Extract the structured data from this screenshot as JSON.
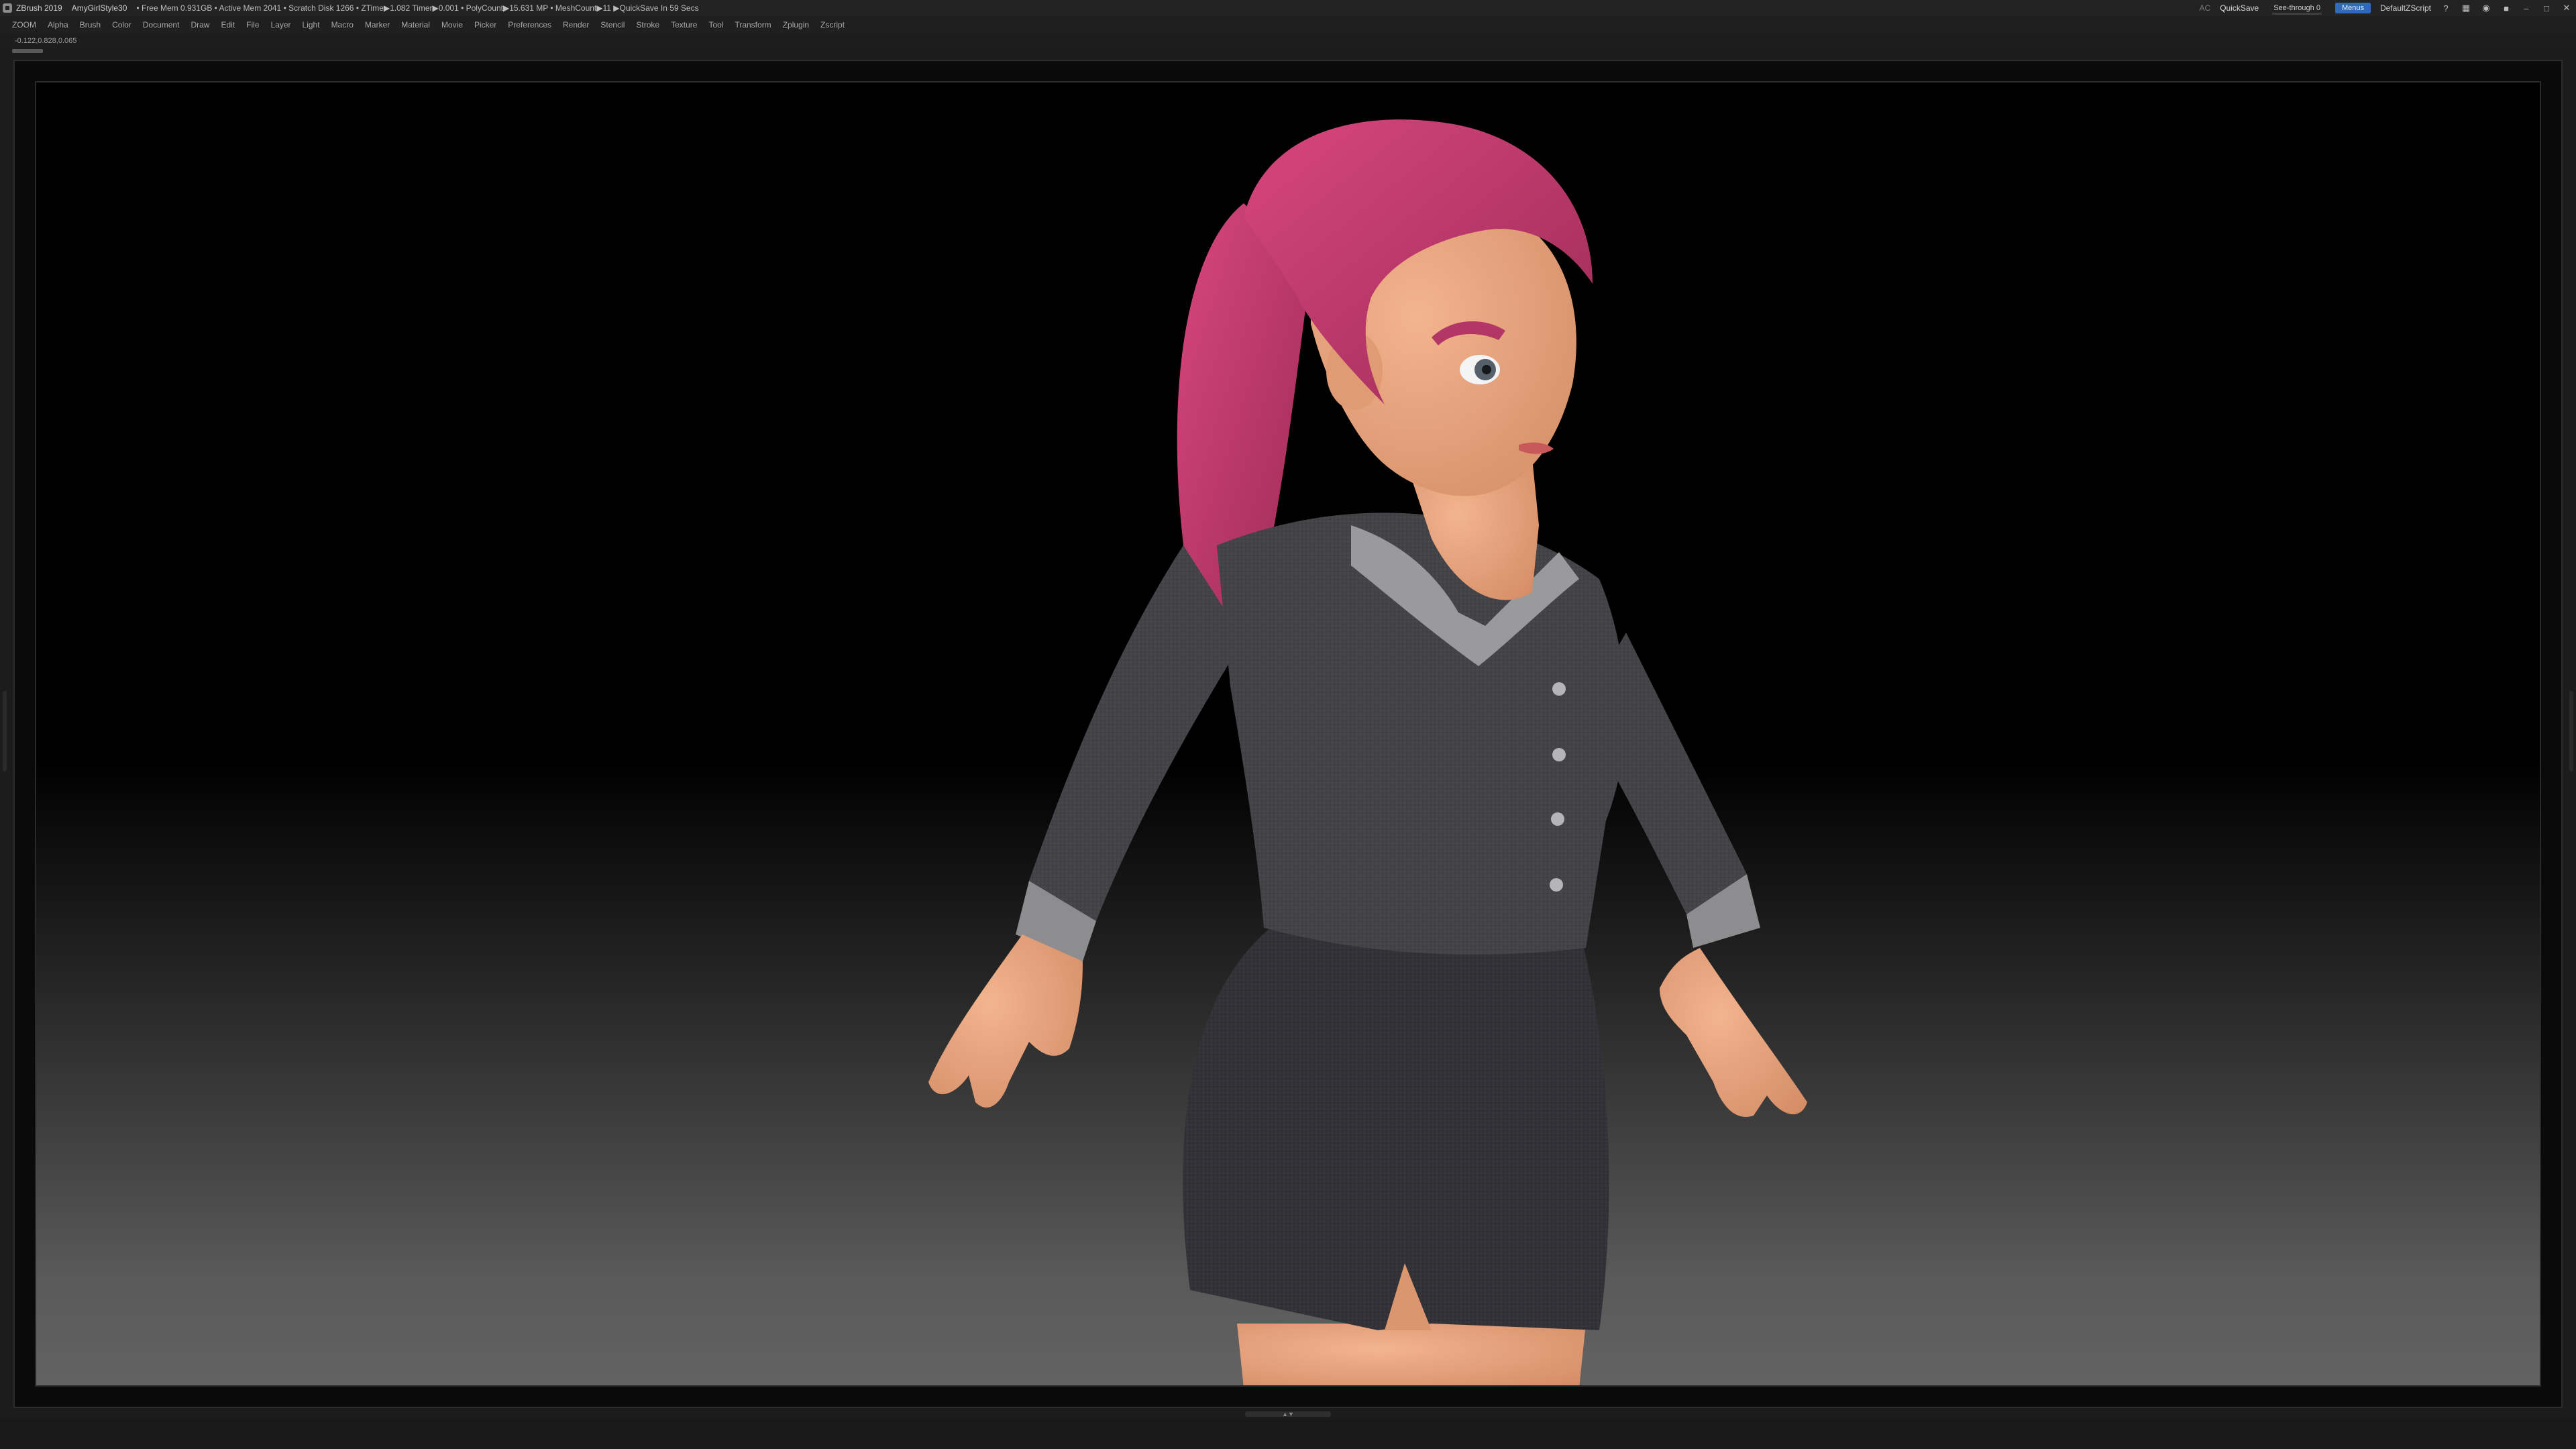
{
  "titlebar": {
    "app": "ZBrush 2019",
    "project": "AmyGirlStyle30",
    "stats": "• Free Mem 0.931GB • Active Mem 2041 • Scratch Disk 1266 • ZTime▶1.082 Timer▶0.001 • PolyCount▶15.631 MP • MeshCount▶11 ▶QuickSave In 59 Secs",
    "ac": "AC",
    "quicksave": "QuickSave",
    "see_through": "See-through  0",
    "see_through_level": 0,
    "menus": "Menus",
    "default_script": "DefaultZScript"
  },
  "menubar": {
    "items": [
      "Alpha",
      "Brush",
      "Color",
      "Document",
      "Draw",
      "Edit",
      "File",
      "Layer",
      "Light",
      "Macro",
      "Marker",
      "Material",
      "Movie",
      "Picker",
      "Preferences",
      "Render",
      "Stencil",
      "Stroke",
      "Texture",
      "Tool",
      "Transform",
      "Zplugin",
      "Zscript"
    ],
    "logo": "ZOOM"
  },
  "coords": "-0.122,0.828,0.065",
  "icons": {
    "help": "question-icon",
    "layout": "layout-icon",
    "palette": "palette-icon",
    "lock": "lock-icon",
    "minimize": "minimize-icon",
    "maximize": "maximize-icon",
    "close": "close-icon"
  },
  "colors": {
    "hair": "#c03a6a",
    "skin": "#e8a27a",
    "jacket": "#4a4a4e",
    "skirt": "#37373c",
    "accent": "#2f69b8"
  }
}
